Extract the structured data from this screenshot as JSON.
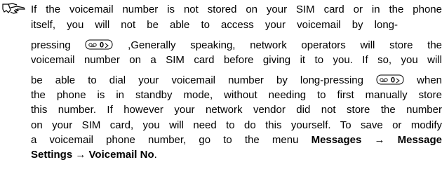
{
  "note": {
    "line1": "If the voicemail number is not stored on your SIM card or in the phone",
    "line2": "itself, you will not be able to access your voicemail by long-",
    "line3_before": "pressing",
    "line3_after": ",Generally speaking, network operators will store the",
    "line4": "voicemail number on a SIM card before giving it to you. If so, you will",
    "line5_before": "be able to dial your voicemail number by long-pressing",
    "line5_after": "when",
    "line6": "the phone is in standby mode, without needing to first manually store",
    "line7": "this number. If however your network vendor did not store the number",
    "line8": "on your SIM card, you will need to do this yourself. To save or modify",
    "line9_before": "a voicemail phone number, go to the menu",
    "menu_messages": "Messages",
    "arrow": "→",
    "menu_message": "Message",
    "menu_settings": "Settings",
    "menu_voicemail": "Voicemail No",
    "line10_end": "."
  },
  "key_label": "0",
  "icons": {
    "note": "pointing-hand-icon",
    "key": "zero-voicemail-key-icon"
  }
}
